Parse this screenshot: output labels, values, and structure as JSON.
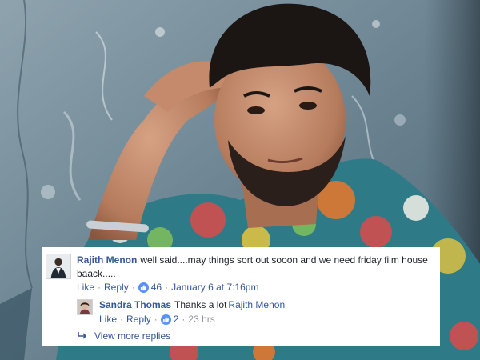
{
  "comment": {
    "author": "Rajith Menon",
    "text": "well said....may things sort out sooon and we need friday film house baack.....",
    "like_label": "Like",
    "reply_label": "Reply",
    "separator": "·",
    "reaction_count": "46",
    "timestamp": "January 6 at 7:16pm"
  },
  "reply": {
    "author": "Sandra Thomas",
    "text": "Thanks a lot",
    "mention": "Rajith Menon",
    "like_label": "Like",
    "reply_label": "Reply",
    "separator": "·",
    "reaction_count": "2",
    "timestamp": "23 hrs"
  },
  "view_more_label": "View more replies",
  "colors": {
    "link_blue": "#365899",
    "meta_gray": "#90949c",
    "like_badge": "#5890ff"
  }
}
